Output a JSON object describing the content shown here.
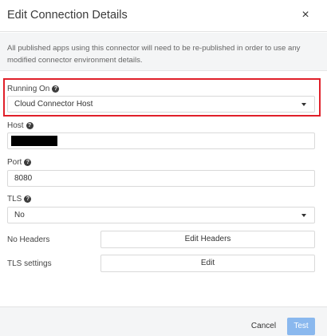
{
  "dialog": {
    "title": "Edit Connection Details",
    "close_glyph": "×"
  },
  "notice": {
    "text": "All published apps using this connector will need to be re-published in order to use any modified connector environment details."
  },
  "running_on": {
    "label": "Running On",
    "value": "Cloud Connector Host"
  },
  "host": {
    "label": "Host",
    "value": ""
  },
  "port": {
    "label": "Port",
    "value": "8080"
  },
  "tls": {
    "label": "TLS",
    "value": "No"
  },
  "headers": {
    "label": "No Headers",
    "button": "Edit Headers"
  },
  "tls_settings": {
    "label": "TLS settings",
    "button": "Edit"
  },
  "footer": {
    "cancel": "Cancel",
    "test": "Test"
  },
  "colors": {
    "highlight": "#e0202a",
    "test_button": "#8ab8ee"
  },
  "icons": {
    "help": "question-circle-icon",
    "close": "close-icon",
    "caret": "caret-down-icon"
  }
}
